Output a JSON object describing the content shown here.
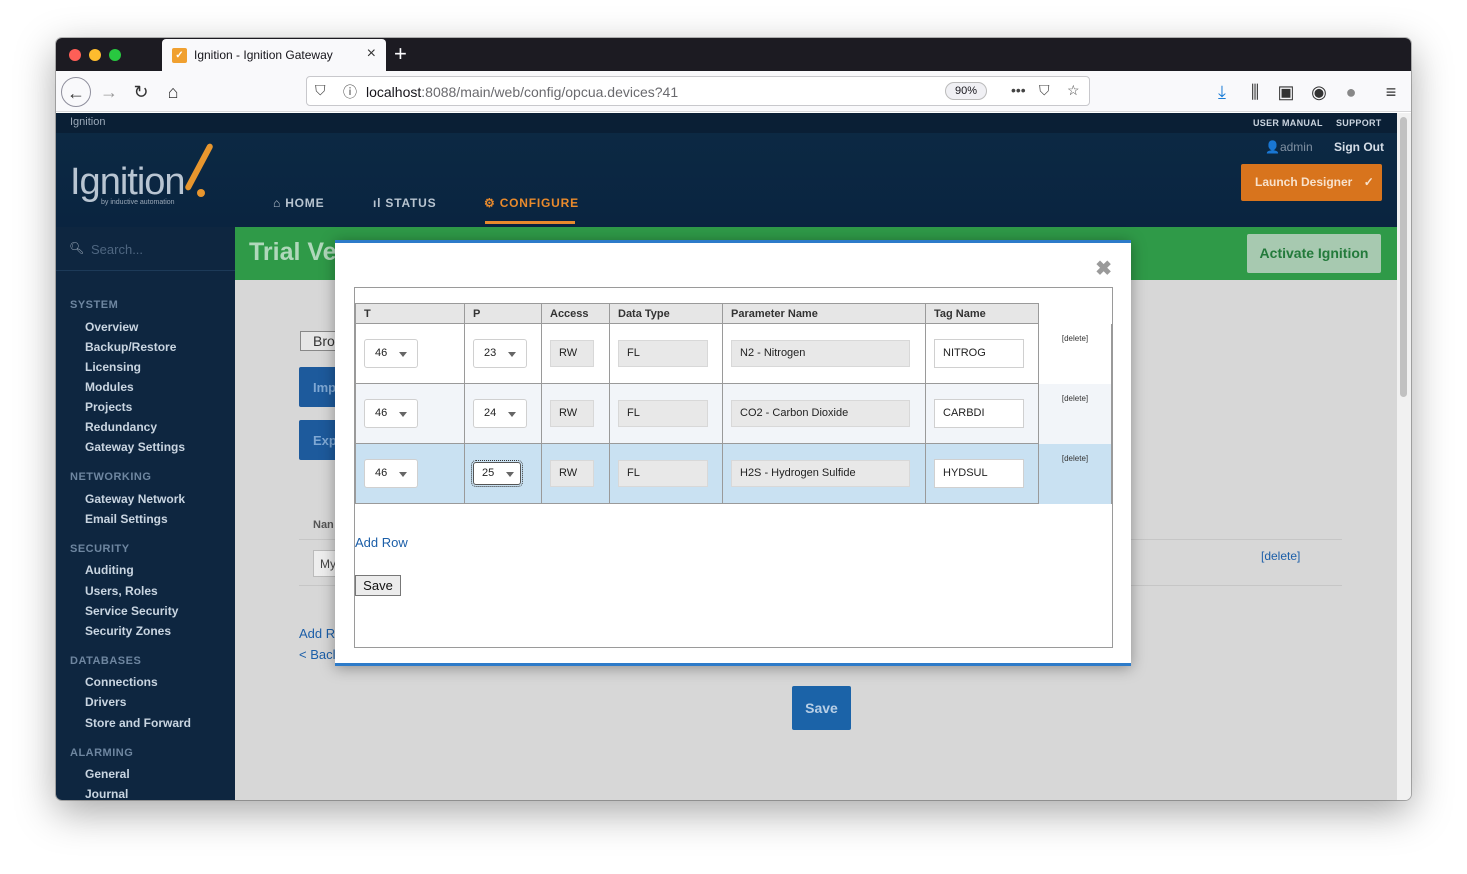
{
  "browser": {
    "tab_title": "Ignition - Ignition Gateway",
    "url_host": "localhost",
    "url_path": ":8088/main/web/config/opcua.devices?41",
    "zoom": "90%"
  },
  "header": {
    "brand_small": "Ignition",
    "user_manual": "USER MANUAL",
    "support": "SUPPORT",
    "logo_text": "Ignition",
    "logo_sub": "by inductive automation",
    "admin": "admin",
    "sign_out": "Sign Out",
    "launch_designer": "Launch Designer",
    "nav": [
      {
        "label": "HOME"
      },
      {
        "label": "STATUS"
      },
      {
        "label": "CONFIGURE"
      }
    ]
  },
  "sidebar": {
    "search_placeholder": "Search...",
    "sections": [
      {
        "title": "SYSTEM",
        "items": [
          "Overview",
          "Backup/Restore",
          "Licensing",
          "Modules",
          "Projects",
          "Redundancy",
          "Gateway Settings"
        ]
      },
      {
        "title": "NETWORKING",
        "items": [
          "Gateway Network",
          "Email Settings"
        ]
      },
      {
        "title": "SECURITY",
        "items": [
          "Auditing",
          "Users, Roles",
          "Service Security",
          "Security Zones"
        ]
      },
      {
        "title": "DATABASES",
        "items": [
          "Connections",
          "Drivers",
          "Store and Forward"
        ]
      },
      {
        "title": "ALARMING",
        "items": [
          "General",
          "Journal"
        ]
      }
    ]
  },
  "content": {
    "trial_title": "Trial Ve",
    "activate": "Activate Ignition",
    "bro": "Bro",
    "imp": "Imp",
    "exp": "Exp",
    "nam": "Nan",
    "my": "My",
    "add_r": "Add R",
    "back": "< Bacl",
    "delete": "[delete]",
    "save": "Save"
  },
  "modal": {
    "columns": [
      "T",
      "P",
      "Access",
      "Data Type",
      "Parameter Name",
      "Tag Name"
    ],
    "rows": [
      {
        "t": "46",
        "p": "23",
        "access": "RW",
        "data_type": "FL",
        "param_name": "N2 - Nitrogen",
        "tag_name": "NITROG",
        "delete": "[delete]"
      },
      {
        "t": "46",
        "p": "24",
        "access": "RW",
        "data_type": "FL",
        "param_name": "CO2 - Carbon Dioxide",
        "tag_name": "CARBDI",
        "delete": "[delete]"
      },
      {
        "t": "46",
        "p": "25",
        "access": "RW",
        "data_type": "FL",
        "param_name": "H2S - Hydrogen Sulfide",
        "tag_name": "HYDSUL",
        "delete": "[delete]"
      }
    ],
    "add_row": "Add Row",
    "save": "Save"
  },
  "colors": {
    "accent_orange": "#e98a2c",
    "trial_green": "#2f9a48",
    "modal_blue": "#2d7bc9",
    "highlight_row": "#c9e1f2"
  }
}
